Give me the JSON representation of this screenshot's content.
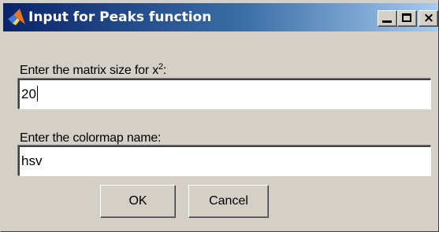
{
  "window": {
    "title": "Input for Peaks function",
    "icon": "matlab-logo-icon",
    "controls": {
      "minimize": "_",
      "maximize": "□",
      "close": "×"
    }
  },
  "prompts": [
    {
      "label_text": "Enter the matrix size for x",
      "label_superscript": "2",
      "label_suffix": ":",
      "value": "20"
    },
    {
      "label_text": "Enter the colormap name:",
      "value": "hsv"
    }
  ],
  "buttons": {
    "ok": "OK",
    "cancel": "Cancel"
  },
  "colors": {
    "title_gradient_start": "#0a246a",
    "title_gradient_end": "#a6caf0",
    "face": "#d4d0c8"
  }
}
